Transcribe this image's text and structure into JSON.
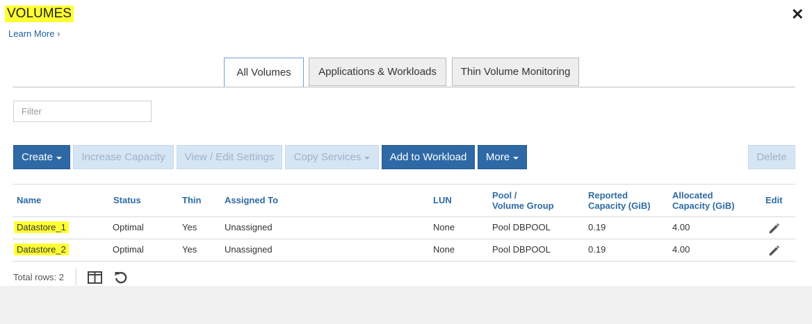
{
  "header": {
    "title": "VOLUMES",
    "learn_more": "Learn More ›",
    "close_glyph": "✕"
  },
  "tabs": [
    {
      "label": "All Volumes",
      "active": true
    },
    {
      "label": "Applications & Workloads",
      "active": false
    },
    {
      "label": "Thin Volume Monitoring",
      "active": false
    }
  ],
  "filter": {
    "placeholder": "Filter",
    "value": ""
  },
  "toolbar": {
    "create": "Create",
    "increase_capacity": "Increase Capacity",
    "view_edit_settings": "View / Edit Settings",
    "copy_services": "Copy Services",
    "add_to_workload": "Add to Workload",
    "more": "More",
    "delete": "Delete"
  },
  "table": {
    "headers": {
      "name": "Name",
      "status": "Status",
      "thin": "Thin",
      "assigned_to": "Assigned To",
      "lun": "LUN",
      "pool_line1": "Pool /",
      "pool_line2": "Volume Group",
      "reported_line1": "Reported",
      "reported_line2": "Capacity (GiB)",
      "allocated_line1": "Allocated",
      "allocated_line2": "Capacity (GiB)",
      "edit": "Edit"
    },
    "rows": [
      {
        "name": "Datastore_1",
        "status": "Optimal",
        "thin": "Yes",
        "assigned_to": "Unassigned",
        "lun": "None",
        "pool": "Pool DBPOOL",
        "reported": "0.19",
        "allocated": "4.00"
      },
      {
        "name": "Datastore_2",
        "status": "Optimal",
        "thin": "Yes",
        "assigned_to": "Unassigned",
        "lun": "None",
        "pool": "Pool DBPOOL",
        "reported": "0.19",
        "allocated": "4.00"
      }
    ]
  },
  "footer": {
    "total_rows": "Total rows: 2"
  },
  "icons": {
    "edit": "pencil-icon",
    "columns": "columns-icon",
    "refresh": "refresh-icon",
    "close": "close-icon"
  },
  "colors": {
    "primary": "#2e69a6",
    "highlight": "#ffff33",
    "header_text": "#2e6aa3"
  }
}
